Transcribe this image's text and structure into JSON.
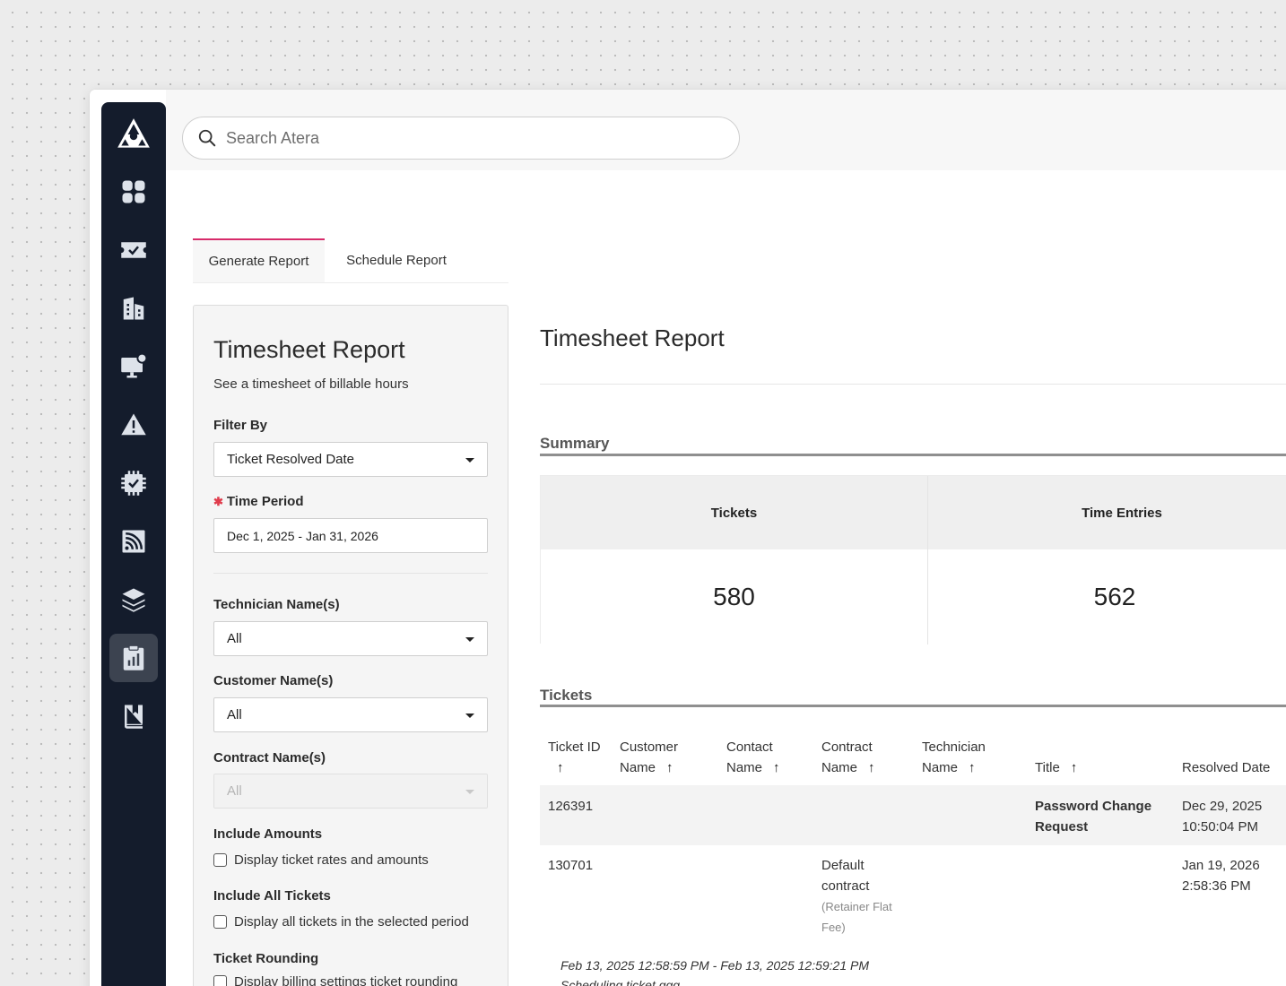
{
  "search": {
    "placeholder": "Search Atera"
  },
  "sidebar": {
    "items": [
      {
        "icon": "atera-logo-icon"
      },
      {
        "icon": "dashboard-icon"
      },
      {
        "icon": "tickets-icon"
      },
      {
        "icon": "customers-icon"
      },
      {
        "icon": "devices-icon"
      },
      {
        "icon": "alerts-icon"
      },
      {
        "icon": "billing-icon"
      },
      {
        "icon": "network-discovery-icon"
      },
      {
        "icon": "app-center-icon"
      },
      {
        "icon": "reports-icon",
        "active": true
      },
      {
        "icon": "knowledge-base-icon"
      }
    ]
  },
  "tabs": {
    "generate": "Generate Report",
    "schedule": "Schedule Report"
  },
  "panel": {
    "title": "Timesheet Report",
    "subtitle": "See a timesheet of billable hours",
    "filter_by": {
      "label": "Filter By",
      "value": "Ticket Resolved Date"
    },
    "time_period": {
      "label": "Time Period",
      "value": "Dec 1, 2025 - Jan 31, 2026"
    },
    "technician": {
      "label": "Technician Name(s)",
      "value": "All"
    },
    "customer": {
      "label": "Customer Name(s)",
      "value": "All"
    },
    "contract": {
      "label": "Contract Name(s)",
      "value": "All"
    },
    "include_amounts": {
      "label": "Include Amounts",
      "checkbox": "Display ticket rates and amounts"
    },
    "include_all_tickets": {
      "label": "Include All Tickets",
      "checkbox": "Display all tickets in the selected period"
    },
    "ticket_rounding": {
      "label": "Ticket Rounding",
      "checkbox": "Display billing settings ticket rounding"
    }
  },
  "report": {
    "title": "Timesheet Report",
    "summary": {
      "heading": "Summary",
      "columns": [
        "Tickets",
        "Time Entries"
      ],
      "values": [
        "580",
        "562"
      ]
    },
    "tickets": {
      "heading": "Tickets",
      "headers": {
        "ticket_id": "Ticket ID",
        "customer_1": "Customer",
        "customer_2": "Name",
        "contact_1": "Contact",
        "contact_2": "Name",
        "contract_1": "Contract",
        "contract_2": "Name",
        "technician_1": "Technician",
        "technician_2": "Name",
        "title": "Title",
        "resolved": "Resolved Date",
        "arrow": "↑"
      },
      "rows": [
        {
          "id": "126391",
          "title_1": "Password Change",
          "title_2": "Request",
          "resolved_1": "Dec 29, 2025",
          "resolved_2": "10:50:04 PM"
        },
        {
          "id": "130701",
          "contract_1": "Default",
          "contract_2": "contract",
          "contract_note_1": "(Retainer Flat",
          "contract_note_2": "Fee)",
          "resolved_1": "Jan 19, 2026",
          "resolved_2": "2:58:36 PM"
        }
      ],
      "time_entry": {
        "range": "Feb 13, 2025 12:58:59 PM - Feb 13, 2025 12:59:21 PM",
        "description": "Scheduling ticket ggg"
      }
    }
  }
}
